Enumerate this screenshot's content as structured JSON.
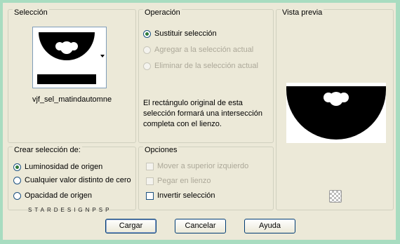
{
  "seleccion": {
    "title": "Selección",
    "selection_name": "vjf_sel_matindautomne"
  },
  "operacion": {
    "title": "Operación",
    "options": [
      {
        "label": "Sustituir selección",
        "checked": true,
        "enabled": true
      },
      {
        "label": "Agregar a la selección actual",
        "checked": false,
        "enabled": false
      },
      {
        "label": "Eliminar de la selección actual",
        "checked": false,
        "enabled": false
      }
    ],
    "description": "El rectángulo original de esta selección formará una intersección completa con el lienzo."
  },
  "vista_previa": {
    "title": "Vista previa"
  },
  "crear": {
    "title": "Crear selección de:",
    "options": [
      {
        "label": "Luminosidad de origen",
        "checked": true
      },
      {
        "label": "Cualquier valor distinto de cero",
        "checked": false
      },
      {
        "label": "Opacidad de origen",
        "checked": false
      }
    ]
  },
  "opciones": {
    "title": "Opciones",
    "items": [
      {
        "label": "Mover a superior izquierdo",
        "checked": false,
        "enabled": false
      },
      {
        "label": "Pegar en lienzo",
        "checked": false,
        "enabled": false
      },
      {
        "label": "Invertir selección",
        "checked": false,
        "enabled": true
      }
    ]
  },
  "watermark": "STARDESIGNPSP",
  "buttons": {
    "load": "Cargar",
    "cancel": "Cancelar",
    "help": "Ayuda"
  },
  "colors": {
    "frame": "#a8dcc0",
    "dialog_bg": "#ece9d8",
    "radio_dot": "#2d7a3a"
  }
}
